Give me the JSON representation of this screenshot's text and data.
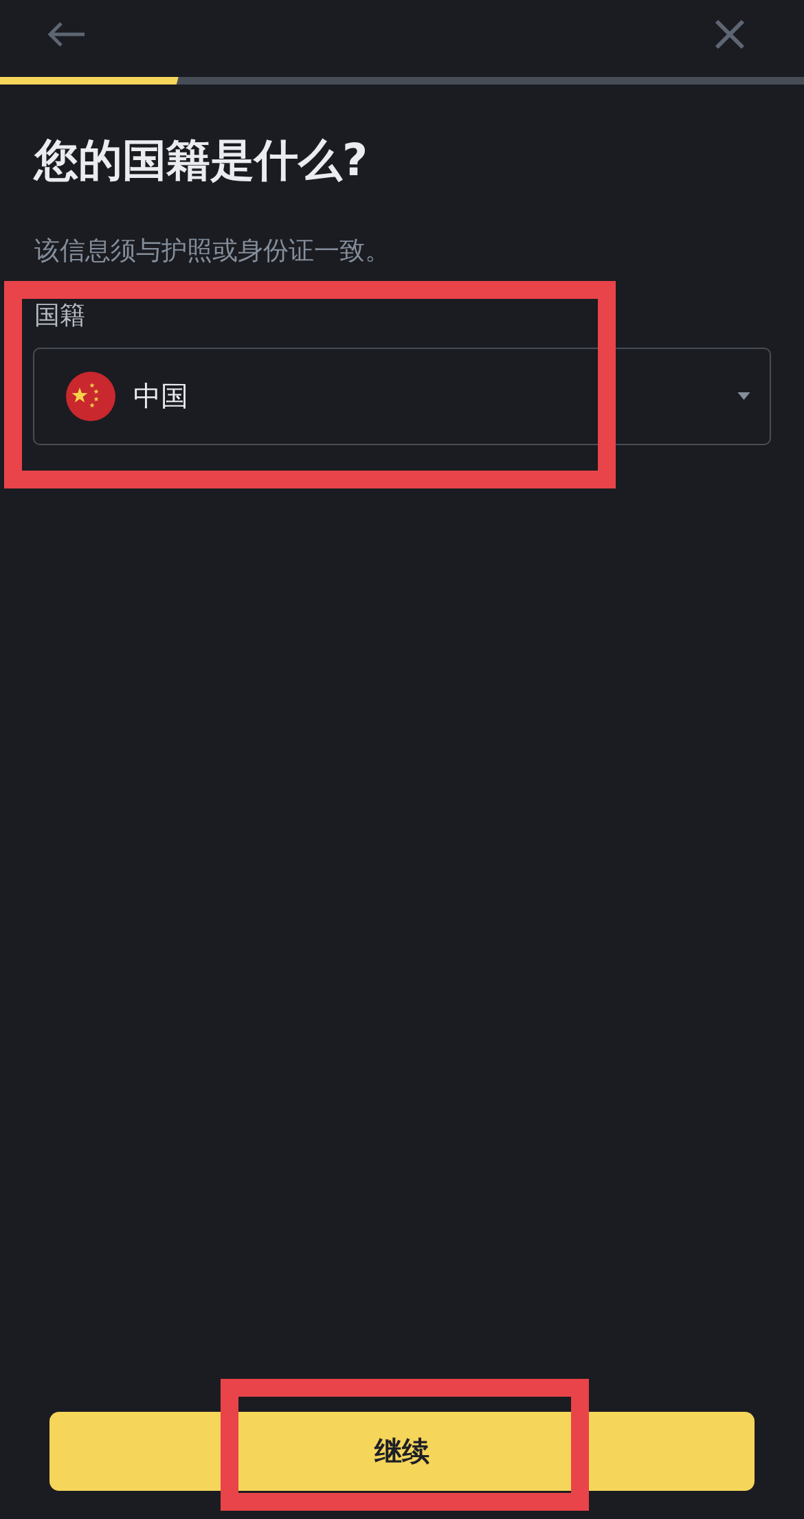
{
  "progress": {
    "level": 0.222
  },
  "title": "您的国籍是什么?",
  "subtitle": "该信息须与护照或身份证一致。",
  "nationality": {
    "label": "国籍",
    "value": "中国",
    "highlighted": true
  },
  "continue_button": {
    "label": "继续",
    "highlighted": true
  }
}
